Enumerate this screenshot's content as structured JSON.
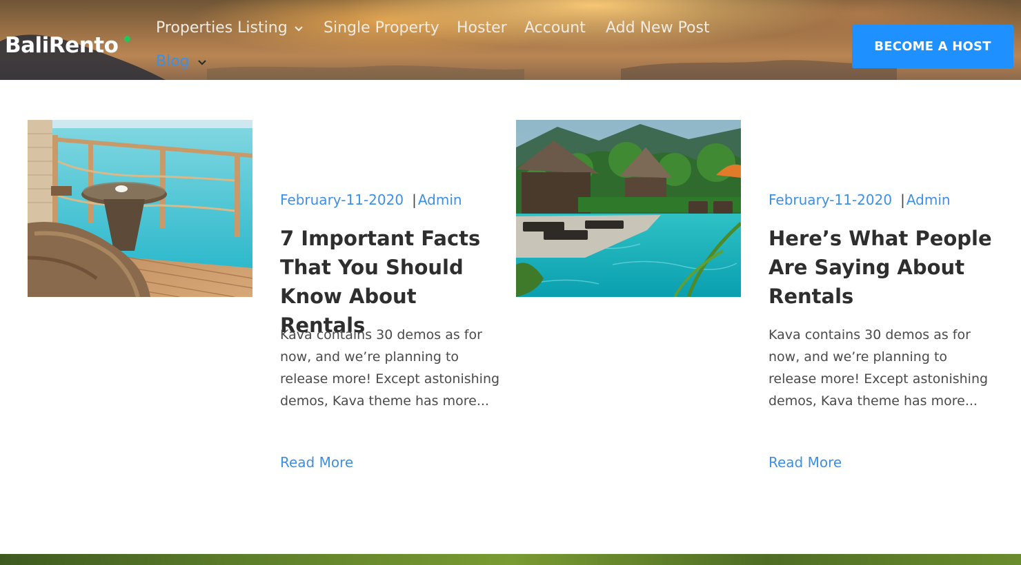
{
  "header": {
    "logo": "BaliRento",
    "nav": [
      {
        "label": "Properties Listing",
        "has_dropdown": true
      },
      {
        "label": "Single Property",
        "has_dropdown": false
      },
      {
        "label": "Hoster",
        "has_dropdown": false
      },
      {
        "label": "Account",
        "has_dropdown": false
      },
      {
        "label": "Add New Post",
        "has_dropdown": false
      },
      {
        "label": "Blog",
        "has_dropdown": true,
        "active": true
      }
    ],
    "cta_label": "BECOME A HOST"
  },
  "posts": [
    {
      "image": "overwater-deck-with-wicker-chairs",
      "date": "February-11-2020",
      "separator": "|",
      "author": "Admin",
      "title": "7 Important Facts That You Should Know About Rentals",
      "excerpt": "Kava contains 30 demos as for now, and we’re planning to release more! Except astonishing demos, Kava theme has more...",
      "read_more": "Read More"
    },
    {
      "image": "tropical-resort-pool",
      "date": "February-11-2020",
      "separator": "|",
      "author": "Admin",
      "title": "Here’s What People Are Saying About Rentals",
      "excerpt": "Kava contains 30 demos as for now, and we’re planning to release more! Except astonishing demos, Kava theme has more...",
      "read_more": "Read More"
    }
  ],
  "colors": {
    "accent": "#3d8fe6",
    "cta": "#1e90ff",
    "logo_dot": "#22c55e",
    "title": "#2e2e2e",
    "body_text": "#4a4a4a"
  }
}
